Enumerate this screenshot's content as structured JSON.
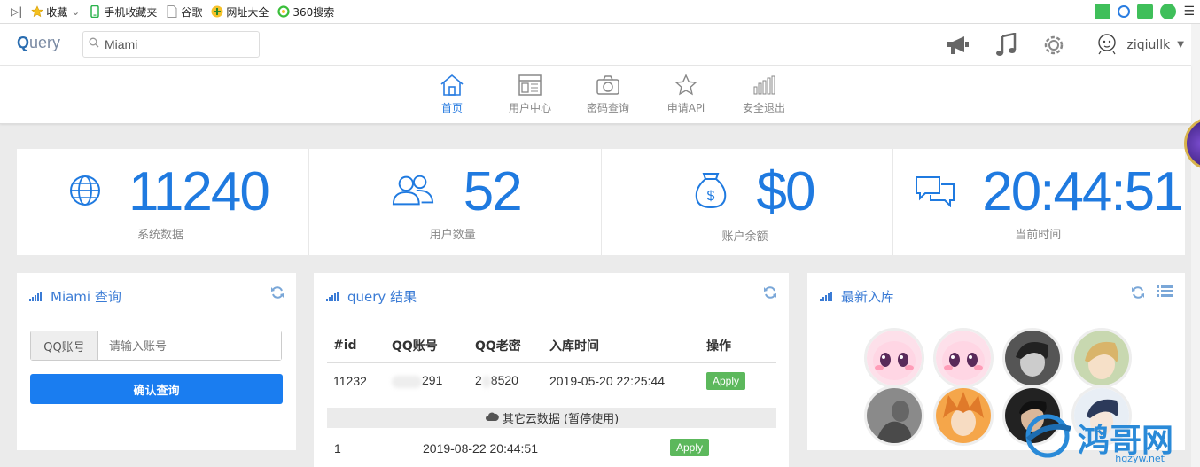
{
  "bookmarks": {
    "items": [
      {
        "icon": "star-icon",
        "label": "收藏",
        "caret": "⌄"
      },
      {
        "icon": "mobile-icon",
        "label": "手机收藏夹"
      },
      {
        "icon": "page-icon",
        "label": "谷歌"
      },
      {
        "icon": "globe-nav-icon",
        "label": "网址大全"
      },
      {
        "icon": "360-icon",
        "label": "360搜索"
      }
    ]
  },
  "header": {
    "brand_q": "Q",
    "brand_rest": "uery",
    "search_value": "Miami",
    "username": "ziqiullk"
  },
  "nav": {
    "items": [
      {
        "label": "首页",
        "icon": "home-icon",
        "active": true
      },
      {
        "label": "用户中心",
        "icon": "user-center-icon",
        "active": false
      },
      {
        "label": "密码查询",
        "icon": "camera-icon",
        "active": false
      },
      {
        "label": "申请APi",
        "icon": "star-outline-icon",
        "active": false
      },
      {
        "label": "安全退出",
        "icon": "bars-icon",
        "active": false
      }
    ]
  },
  "stats": [
    {
      "value": "11240",
      "label": "系统数据",
      "icon": "globe-icon"
    },
    {
      "value": "52",
      "label": "用户数量",
      "icon": "users-icon"
    },
    {
      "value": "$0",
      "label": "账户余额",
      "icon": "money-bag-icon"
    },
    {
      "value": "20:44:51",
      "label": "当前时间",
      "icon": "chat-icon"
    }
  ],
  "query_panel": {
    "title": "Miami 查询",
    "addon": "QQ账号",
    "placeholder": "请输入账号",
    "button": "确认查询"
  },
  "result_panel": {
    "title": "query 结果",
    "headers": [
      "#id",
      "QQ账号",
      "QQ老密",
      "入库时间",
      "操作"
    ],
    "row": {
      "id": "11232",
      "qq": "291",
      "pwd_a": "2",
      "pwd_b": "8520",
      "time": "2019-05-20 22:25:44",
      "action": "Apply"
    },
    "cloud_label": "其它云数据 (暂停使用)",
    "row2": {
      "id": "1",
      "time": "2019-08-22 20:44:51",
      "action": "Apply"
    }
  },
  "latest_panel": {
    "title": "最新入库"
  },
  "watermark": {
    "text": "鸿哥网",
    "sub": "hgzyw.net"
  },
  "colors": {
    "accent": "#1f7ae0",
    "apply": "#5cb85c",
    "button": "#1a7df0"
  }
}
